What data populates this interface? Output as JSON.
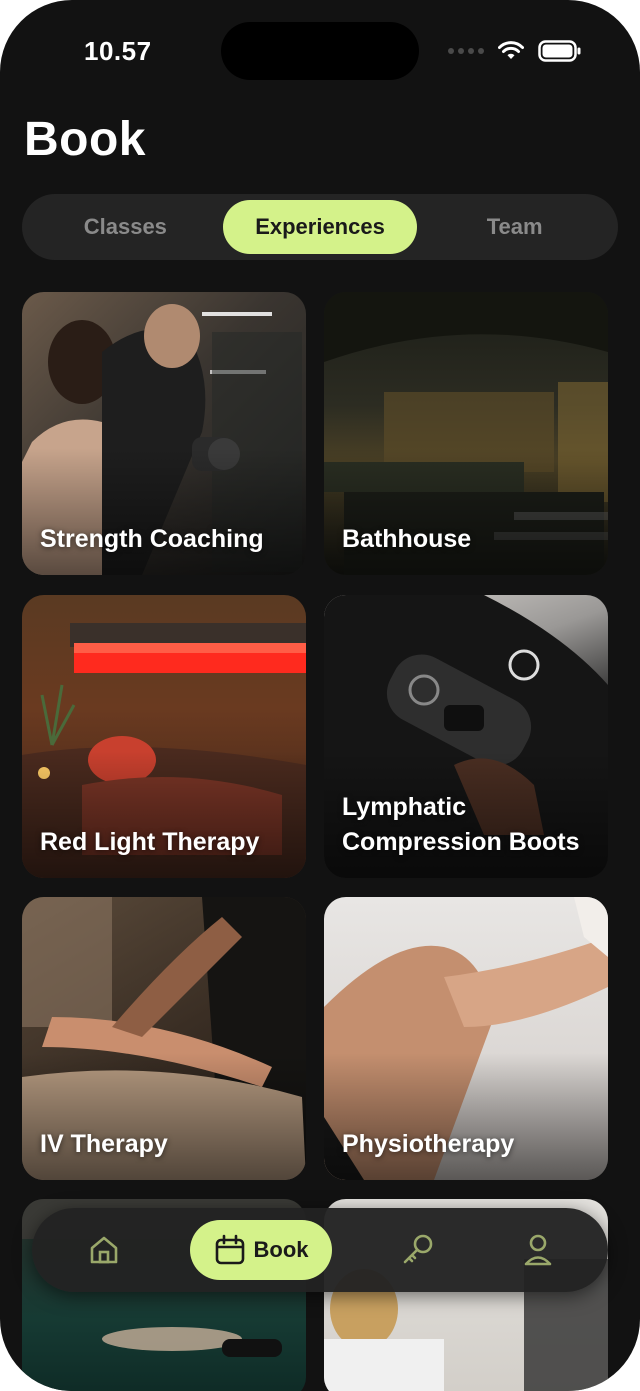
{
  "status_bar": {
    "time": "10.57"
  },
  "header": {
    "title": "Book"
  },
  "segments": [
    {
      "label": "Classes",
      "active": false
    },
    {
      "label": "Experiences",
      "active": true
    },
    {
      "label": "Team",
      "active": false
    }
  ],
  "experiences": [
    {
      "label": "Strength Coaching"
    },
    {
      "label": "Bathhouse"
    },
    {
      "label": "Red Light Therapy"
    },
    {
      "label": "Lymphatic Compression Boots"
    },
    {
      "label": "IV Therapy"
    },
    {
      "label": "Physiotherapy"
    }
  ],
  "tabbar": {
    "items": [
      {
        "icon": "home-icon"
      },
      {
        "icon": "calendar-icon",
        "label": "Book",
        "active": true
      },
      {
        "icon": "key-icon"
      },
      {
        "icon": "profile-icon"
      }
    ]
  },
  "colors": {
    "accent": "#d4f28a",
    "background": "#121212",
    "surface": "#242424"
  }
}
